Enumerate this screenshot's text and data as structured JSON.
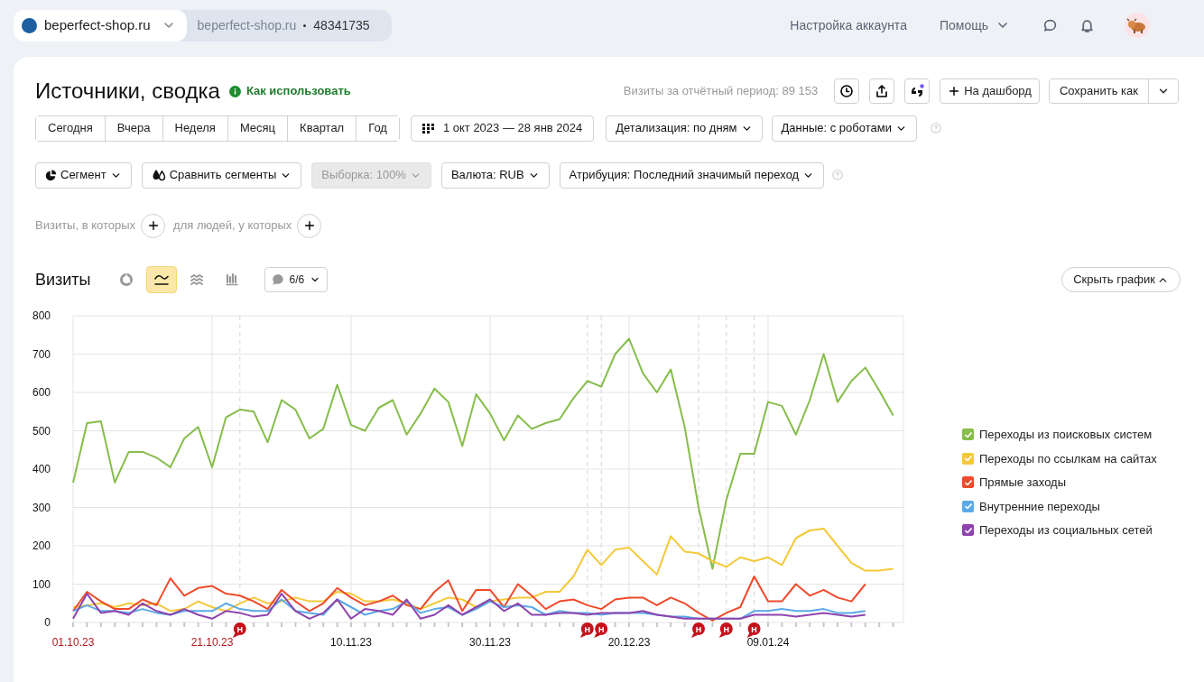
{
  "top_bar": {
    "site_selector": "beperfect-shop.ru",
    "breadcrumb": {
      "site": "beperfect-shop.ru",
      "counter": "48341735"
    },
    "links": [
      {
        "label": "Настройка аккаунта",
        "kind": "link"
      },
      {
        "label": "Помощь",
        "kind": "dropdown"
      }
    ]
  },
  "header": {
    "title": "Источники, сводка",
    "help_link": "Как использовать",
    "visits_total": "Визиты за отчётный период: 89 153",
    "dashboard_button": "На дашборд",
    "save_button": "Сохранить как"
  },
  "periods": [
    {
      "label": "Сегодня",
      "selected": false
    },
    {
      "label": "Вчера",
      "selected": false
    },
    {
      "label": "Неделя",
      "selected": false
    },
    {
      "label": "Месяц",
      "selected": false
    },
    {
      "label": "Квартал",
      "selected": false
    },
    {
      "label": "Год",
      "selected": false
    }
  ],
  "date_range": "1 окт 2023 — 28 янв 2024",
  "filters": [
    "Детализация: по дням",
    "Данные: с роботами"
  ],
  "segment_controls": [
    {
      "label": "Сегмент",
      "kind": "segment",
      "disabled": false
    },
    {
      "label": "Сравнить сегменты",
      "kind": "compare",
      "disabled": false
    },
    {
      "label": "Выборка: 100%",
      "kind": "plain",
      "disabled": true
    },
    {
      "label": "Валюта: RUB",
      "kind": "plain",
      "disabled": false
    },
    {
      "label": "Атрибуция: Последний значимый переход",
      "kind": "plain",
      "disabled": false
    }
  ],
  "conditions": [
    "Визиты, в которых",
    "для людей, у которых"
  ],
  "chart_panel": {
    "title": "Визиты",
    "chart_types": [
      {
        "kind": "pie",
        "selected": false
      },
      {
        "kind": "line",
        "selected": true
      },
      {
        "kind": "area",
        "selected": false
      },
      {
        "kind": "bar",
        "selected": false
      }
    ],
    "notes_filter": "6/6",
    "hide_button": "Скрыть график",
    "legend": [
      {
        "checked": true
      },
      {
        "checked": true
      },
      {
        "checked": true
      },
      {
        "checked": true
      },
      {
        "checked": true
      }
    ],
    "chart_data": {
      "type": "line",
      "ylim": [
        0,
        800
      ],
      "yticks": [
        0,
        100,
        200,
        300,
        400,
        500,
        600,
        700,
        800
      ],
      "grid": true,
      "categories": [
        "01.10.23",
        null,
        null,
        null,
        null,
        null,
        null,
        null,
        null,
        null,
        "21.10.23",
        null,
        null,
        null,
        null,
        null,
        null,
        null,
        null,
        null,
        "10.11.23",
        null,
        null,
        null,
        null,
        null,
        null,
        null,
        null,
        null,
        "30.11.23",
        null,
        null,
        null,
        null,
        null,
        null,
        null,
        null,
        null,
        "20.12.23",
        null,
        null,
        null,
        null,
        null,
        null,
        null,
        null,
        null,
        "09.01.24",
        null,
        null,
        null,
        null,
        null,
        null,
        null,
        null,
        null
      ],
      "series": [
        {
          "name": "Переходы из поисковых систем",
          "color": "#86bd4b",
          "values": [
            365,
            520,
            525,
            365,
            445,
            445,
            430,
            405,
            480,
            510,
            405,
            535,
            555,
            550,
            470,
            580,
            555,
            480,
            505,
            620,
            515,
            500,
            560,
            580,
            490,
            545,
            610,
            575,
            460,
            595,
            545,
            475,
            540,
            505,
            520,
            530,
            585,
            630,
            615,
            700,
            740,
            650,
            600,
            660,
            510,
            300,
            140,
            320,
            440,
            440,
            575,
            565,
            490,
            580,
            700,
            575,
            630,
            665,
            605,
            540
          ]
        },
        {
          "name": "Переходы по ссылкам на сайтах",
          "color": "#f4c93a",
          "values": [
            40,
            45,
            50,
            40,
            50,
            45,
            50,
            30,
            35,
            55,
            40,
            30,
            50,
            65,
            50,
            55,
            65,
            55,
            55,
            80,
            75,
            55,
            55,
            60,
            50,
            35,
            50,
            65,
            60,
            40,
            55,
            60,
            65,
            65,
            80,
            80,
            120,
            190,
            150,
            190,
            195,
            160,
            125,
            225,
            185,
            180,
            160,
            145,
            170,
            160,
            170,
            150,
            220,
            240,
            245,
            200,
            155,
            135,
            135,
            140
          ]
        },
        {
          "name": "Прямые заходы",
          "color": "#ef4a2b",
          "values": [
            30,
            80,
            55,
            35,
            35,
            60,
            45,
            115,
            70,
            90,
            95,
            75,
            70,
            55,
            35,
            85,
            55,
            30,
            50,
            90,
            65,
            45,
            55,
            70,
            45,
            35,
            80,
            110,
            30,
            85,
            85,
            40,
            100,
            70,
            35,
            55,
            60,
            45,
            35,
            60,
            65,
            65,
            45,
            65,
            50,
            25,
            5,
            25,
            40,
            120,
            55,
            55,
            100,
            70,
            85,
            65,
            55,
            100,
            null,
            null
          ]
        },
        {
          "name": "Внутренние переходы",
          "color": "#5aa9e6",
          "values": [
            30,
            45,
            30,
            30,
            25,
            35,
            25,
            20,
            30,
            30,
            30,
            50,
            35,
            30,
            30,
            60,
            30,
            25,
            20,
            60,
            40,
            20,
            30,
            35,
            55,
            25,
            35,
            40,
            20,
            35,
            55,
            40,
            45,
            40,
            20,
            30,
            25,
            25,
            20,
            25,
            25,
            25,
            20,
            15,
            15,
            10,
            10,
            10,
            10,
            30,
            30,
            35,
            30,
            30,
            35,
            25,
            25,
            30,
            null,
            null
          ]
        },
        {
          "name": "Переходы из социальных сетей",
          "color": "#8e44ad",
          "values": [
            10,
            75,
            25,
            30,
            20,
            50,
            30,
            20,
            35,
            20,
            10,
            30,
            25,
            15,
            20,
            75,
            30,
            10,
            25,
            60,
            10,
            35,
            30,
            20,
            60,
            10,
            20,
            45,
            20,
            40,
            60,
            30,
            50,
            20,
            20,
            25,
            25,
            20,
            25,
            25,
            25,
            30,
            20,
            15,
            10,
            10,
            10,
            10,
            10,
            20,
            20,
            20,
            15,
            20,
            25,
            20,
            15,
            20,
            null,
            null
          ]
        }
      ]
    },
    "days": [
      {
        "holiday": false
      },
      {
        "holiday": false
      },
      {
        "holiday": false
      },
      {
        "holiday": false
      },
      {
        "holiday": false
      },
      {
        "holiday": false
      },
      {
        "holiday": false
      },
      {
        "holiday": false
      },
      {
        "holiday": false
      },
      {
        "holiday": false
      },
      {
        "holiday": false
      },
      {
        "holiday": false
      },
      {
        "holiday": true,
        "marker": "Н"
      },
      {
        "holiday": false
      },
      {
        "holiday": false
      },
      {
        "holiday": false
      },
      {
        "holiday": false
      },
      {
        "holiday": false
      },
      {
        "holiday": false
      },
      {
        "holiday": false
      },
      {
        "holiday": false
      },
      {
        "holiday": false
      },
      {
        "holiday": false
      },
      {
        "holiday": false
      },
      {
        "holiday": false
      },
      {
        "holiday": false
      },
      {
        "holiday": false
      },
      {
        "holiday": false
      },
      {
        "holiday": false
      },
      {
        "holiday": false
      },
      {
        "holiday": false
      },
      {
        "holiday": false
      },
      {
        "holiday": false
      },
      {
        "holiday": false
      },
      {
        "holiday": false
      },
      {
        "holiday": false
      },
      {
        "holiday": false
      },
      {
        "holiday": true,
        "marker": "Н"
      },
      {
        "holiday": true,
        "marker": "Н"
      },
      {
        "holiday": false
      },
      {
        "holiday": false
      },
      {
        "holiday": false
      },
      {
        "holiday": false
      },
      {
        "holiday": false
      },
      {
        "holiday": false
      },
      {
        "holiday": true,
        "marker": "Н"
      },
      {
        "holiday": false
      },
      {
        "holiday": true,
        "marker": "Н"
      },
      {
        "holiday": false
      },
      {
        "holiday": true,
        "marker": "Н"
      },
      {
        "holiday": false
      },
      {
        "holiday": false
      },
      {
        "holiday": false
      },
      {
        "holiday": false
      },
      {
        "holiday": false
      },
      {
        "holiday": false
      },
      {
        "holiday": false
      },
      {
        "holiday": false
      },
      {
        "holiday": false
      },
      {
        "holiday": false
      }
    ]
  }
}
